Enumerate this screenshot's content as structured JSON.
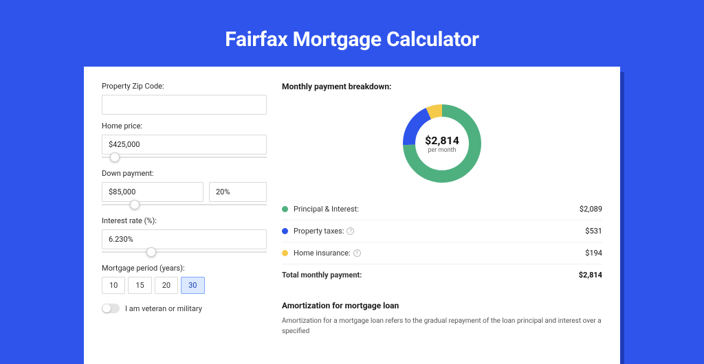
{
  "title": "Fairfax Mortgage Calculator",
  "form": {
    "zip_label": "Property Zip Code:",
    "zip_value": "",
    "price_label": "Home price:",
    "price_value": "$425,000",
    "price_slider_pct": 8,
    "down_label": "Down payment:",
    "down_value": "$85,000",
    "down_pct_value": "20%",
    "down_slider_pct": 20,
    "rate_label": "Interest rate (%):",
    "rate_value": "6.230%",
    "rate_slider_pct": 30,
    "period_label": "Mortgage period (years):",
    "periods": [
      "10",
      "15",
      "20",
      "30"
    ],
    "period_active": "30",
    "vet_label": "I am veteran or military",
    "vet_on": false
  },
  "breakdown": {
    "title": "Monthly payment breakdown:",
    "donut_total": "$2,814",
    "donut_sub": "per month",
    "rows": [
      {
        "label": "Principal & Interest:",
        "value": "$2,089",
        "color": "#4fb07f",
        "info": false
      },
      {
        "label": "Property taxes:",
        "value": "$531",
        "color": "#2f54eb",
        "info": true
      },
      {
        "label": "Home insurance:",
        "value": "$194",
        "color": "#f5c94a",
        "info": true
      }
    ],
    "total_label": "Total monthly payment:",
    "total_value": "$2,814"
  },
  "chart_data": {
    "type": "pie",
    "title": "Monthly payment breakdown",
    "series": [
      {
        "name": "Principal & Interest",
        "value": 2089,
        "color": "#4fb07f"
      },
      {
        "name": "Property taxes",
        "value": 531,
        "color": "#2f54eb"
      },
      {
        "name": "Home insurance",
        "value": 194,
        "color": "#f5c94a"
      }
    ],
    "total": 2814,
    "unit": "USD/month"
  },
  "amort": {
    "title": "Amortization for mortgage loan",
    "text": "Amortization for a mortgage loan refers to the gradual repayment of the loan principal and interest over a specified"
  }
}
